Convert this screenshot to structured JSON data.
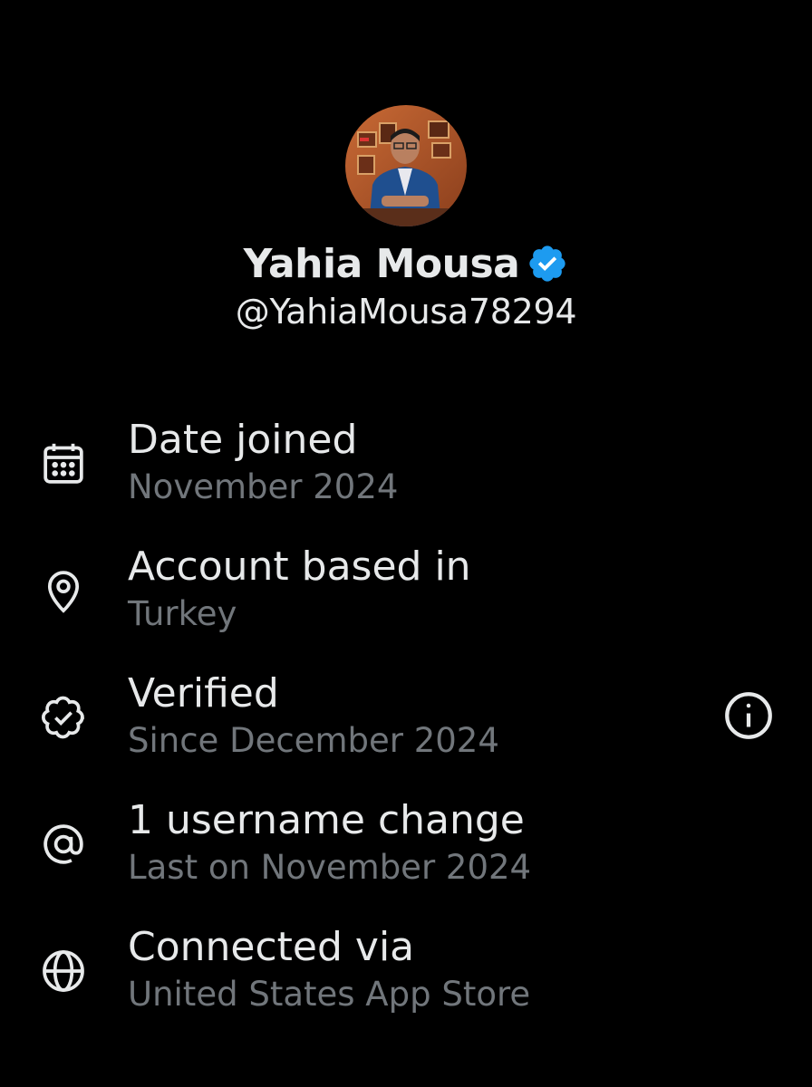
{
  "profile": {
    "display_name": "Yahia Mousa",
    "handle": "@YahiaMousa78294",
    "verified": true,
    "verified_color": "#1d9bf0"
  },
  "about": {
    "items": [
      {
        "icon": "calendar-icon",
        "title": "Date joined",
        "subtitle": "November 2024"
      },
      {
        "icon": "location-pin-icon",
        "title": "Account based in",
        "subtitle": "Turkey"
      },
      {
        "icon": "verified-badge-outline-icon",
        "title": "Verified",
        "subtitle": "Since December 2024"
      },
      {
        "icon": "at-sign-icon",
        "title": "1 username change",
        "subtitle": "Last on November 2024"
      },
      {
        "icon": "globe-icon",
        "title": "Connected via",
        "subtitle": "United States App Store"
      }
    ]
  },
  "colors": {
    "background": "#000000",
    "primary_text": "#e7e9ea",
    "secondary_text": "#71767b"
  }
}
